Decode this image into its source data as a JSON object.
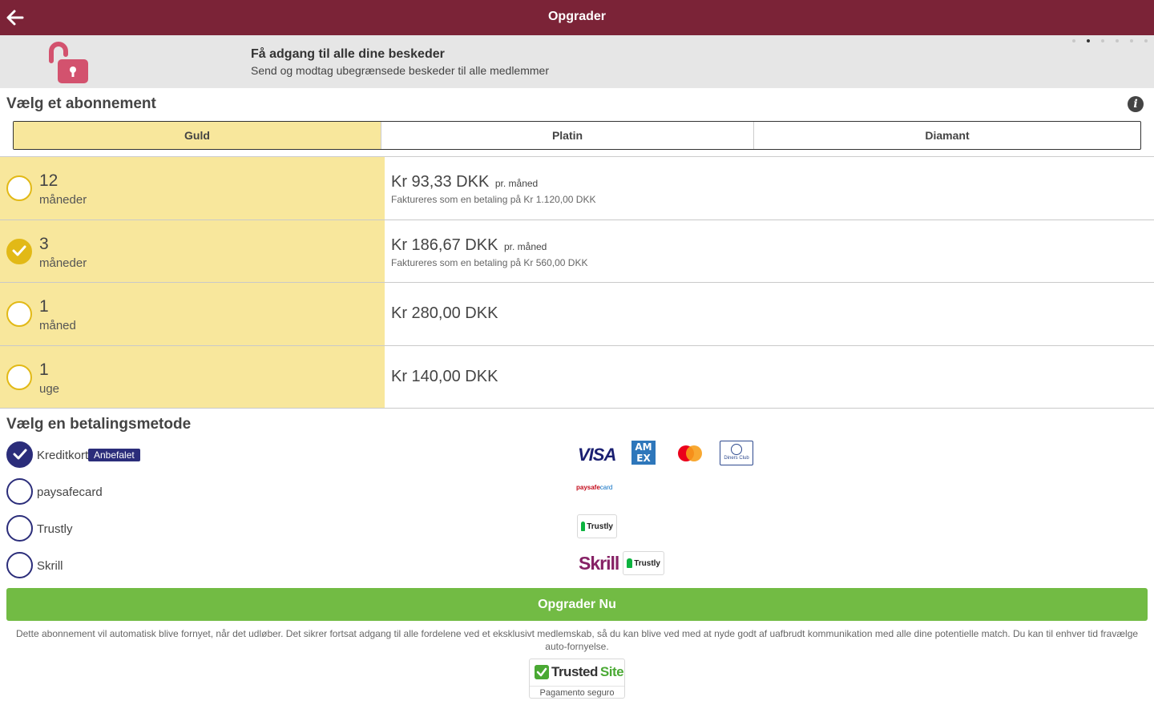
{
  "header": {
    "title": "Opgrader"
  },
  "banner": {
    "title": "Få adgang til alle dine beskeder",
    "subtitle": "Send og modtag ubegrænsede beskeder til alle medlemmer",
    "active_slide": 2,
    "slide_count": 6
  },
  "subscription": {
    "heading": "Vælg et abonnement",
    "tabs": [
      {
        "label": "Guld",
        "selected": true
      },
      {
        "label": "Platin",
        "selected": false
      },
      {
        "label": "Diamant",
        "selected": false
      }
    ],
    "plans": [
      {
        "num": "12",
        "unit": "måneder",
        "price": "Kr 93,33 DKK",
        "per": "pr. måned",
        "billing": "Faktureres som en betaling på Kr 1.120,00 DKK",
        "selected": false
      },
      {
        "num": "3",
        "unit": "måneder",
        "price": "Kr 186,67 DKK",
        "per": "pr. måned",
        "billing": "Faktureres som en betaling på Kr 560,00 DKK",
        "selected": true
      },
      {
        "num": "1",
        "unit": "måned",
        "price": "Kr 280,00 DKK",
        "per": "",
        "billing": "",
        "selected": false
      },
      {
        "num": "1",
        "unit": "uge",
        "price": "Kr 140,00 DKK",
        "per": "",
        "billing": "",
        "selected": false
      }
    ]
  },
  "payment": {
    "heading": "Vælg en betalingsmetode",
    "methods": [
      {
        "label": "Kreditkort",
        "badge": "Anbefalet",
        "selected": true
      },
      {
        "label": "paysafecard",
        "selected": false
      },
      {
        "label": "Trustly",
        "selected": false
      },
      {
        "label": "Skrill",
        "selected": false
      }
    ],
    "logos": {
      "visa": "VISA",
      "amex": "AM EX",
      "diners": "Diners Club",
      "paysafe_a": "paysafe",
      "paysafe_b": "card",
      "trustly": "Trustly",
      "skrill": "Skrill"
    }
  },
  "cta": {
    "label": "Opgrader Nu"
  },
  "disclaimer": "Dette abonnement vil automatisk blive fornyet, når det udløber. Det sikrer fortsat adgang til alle fordelene ved et eksklusivt medlemskab, så du kan blive ved med at nyde godt af uafbrudt kommunikation med alle dine potentielle match. Du kan til enhver tid fravælge auto-fornyelse.",
  "trusted": {
    "name_a": "Trusted",
    "name_b": "Site",
    "sub": "Pagamento seguro"
  },
  "colors": {
    "header_bg": "#7b2337",
    "gold_highlight": "#f8e79c",
    "gold_radio": "#e2b916",
    "payment_radio": "#2b2d7a",
    "cta_green": "#72bb44"
  }
}
